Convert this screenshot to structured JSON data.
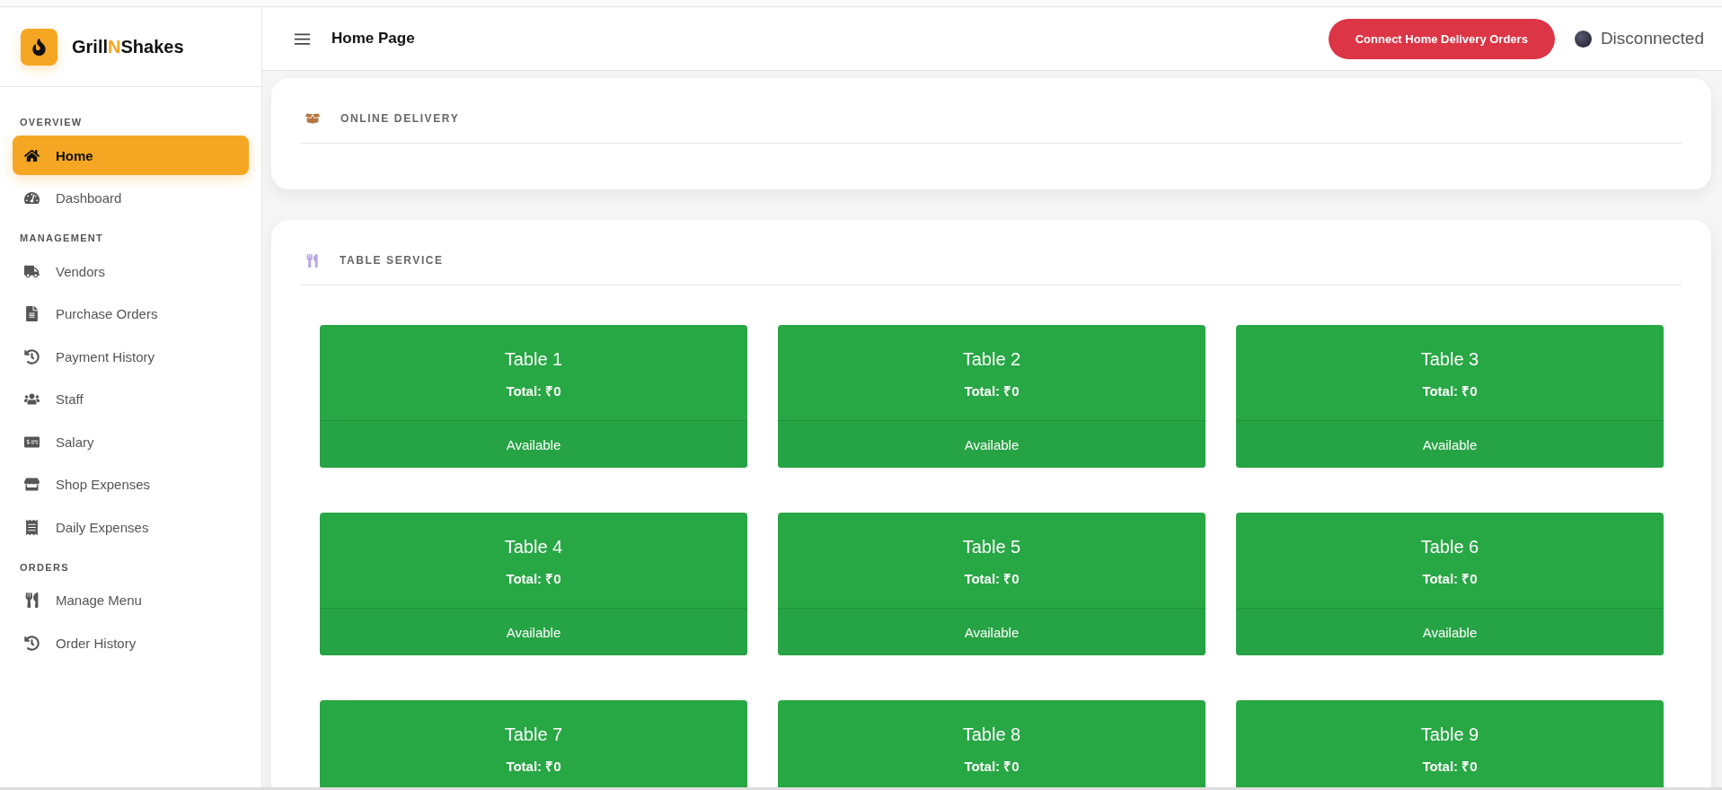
{
  "brand": {
    "name": "Grill",
    "highlight": "N",
    "suffix": "Shakes"
  },
  "sidebar": {
    "sections": [
      {
        "heading": "OVERVIEW",
        "items": [
          {
            "label": "Home",
            "kind": "home",
            "selected": true
          },
          {
            "label": "Dashboard",
            "kind": "gauge",
            "selected": false
          }
        ]
      },
      {
        "heading": "MANAGEMENT",
        "items": [
          {
            "label": "Vendors",
            "kind": "truck",
            "selected": false
          },
          {
            "label": "Purchase Orders",
            "kind": "file",
            "selected": false
          },
          {
            "label": "Payment History",
            "kind": "history",
            "selected": false
          },
          {
            "label": "Staff",
            "kind": "users",
            "selected": false
          },
          {
            "label": "Salary",
            "kind": "money",
            "selected": false
          },
          {
            "label": "Shop Expenses",
            "kind": "store",
            "selected": false
          },
          {
            "label": "Daily Expenses",
            "kind": "receipt",
            "selected": false
          }
        ]
      },
      {
        "heading": "ORDERS",
        "items": [
          {
            "label": "Manage Menu",
            "kind": "utensils",
            "selected": false
          },
          {
            "label": "Order History",
            "kind": "history",
            "selected": false
          }
        ]
      }
    ]
  },
  "header": {
    "title": "Home Page",
    "button": "Connect Home Delivery Orders",
    "status": {
      "label": "Disconnected",
      "connected": false
    }
  },
  "sections": [
    {
      "title": "ONLINE DELIVERY",
      "kind": "package"
    },
    {
      "title": "TABLE SERVICE",
      "kind": "plate",
      "tables": [
        {
          "name": "Table 1",
          "total": "Total: ₹0",
          "status": "Available",
          "occupied": false
        },
        {
          "name": "Table 2",
          "total": "Total: ₹0",
          "status": "Available",
          "occupied": false
        },
        {
          "name": "Table 3",
          "total": "Total: ₹0",
          "status": "Available",
          "occupied": false
        },
        {
          "name": "Table 4",
          "total": "Total: ₹0",
          "status": "Available",
          "occupied": false
        },
        {
          "name": "Table 5",
          "total": "Total: ₹0",
          "status": "Available",
          "occupied": false
        },
        {
          "name": "Table 6",
          "total": "Total: ₹0",
          "status": "Available",
          "occupied": false
        },
        {
          "name": "Table 7",
          "total": "Total: ₹0",
          "occupied": false
        },
        {
          "name": "Table 8",
          "total": "Total: ₹0",
          "occupied": false
        },
        {
          "name": "Table 9",
          "total": "Total: ₹0",
          "occupied": false
        }
      ]
    }
  ]
}
